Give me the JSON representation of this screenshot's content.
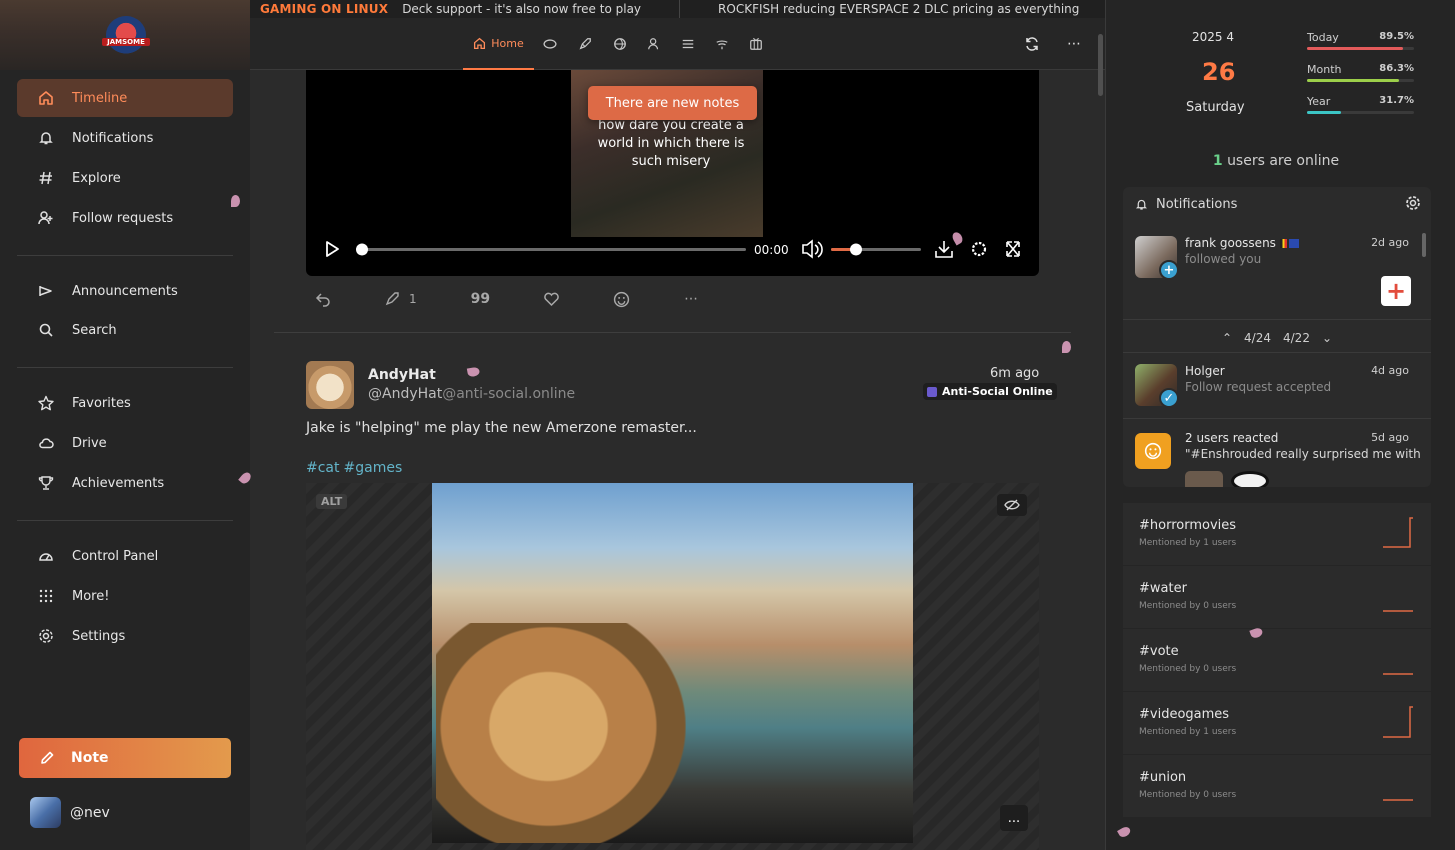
{
  "sidebar": {
    "logo_text": "JAMSOME",
    "items": [
      {
        "label": "Timeline",
        "icon": "home-icon"
      },
      {
        "label": "Notifications",
        "icon": "bell-icon"
      },
      {
        "label": "Explore",
        "icon": "hash-icon"
      },
      {
        "label": "Follow requests",
        "icon": "user-plus-icon"
      },
      {
        "label": "Announcements",
        "icon": "megaphone-icon"
      },
      {
        "label": "Search",
        "icon": "search-icon"
      },
      {
        "label": "Favorites",
        "icon": "star-icon"
      },
      {
        "label": "Drive",
        "icon": "cloud-icon"
      },
      {
        "label": "Achievements",
        "icon": "trophy-icon"
      },
      {
        "label": "Control Panel",
        "icon": "dashboard-icon"
      },
      {
        "label": "More!",
        "icon": "grid-dots-icon"
      },
      {
        "label": "Settings",
        "icon": "gear-icon"
      }
    ],
    "note_label": "Note",
    "account_handle": "@nev",
    "active_color": "#ff8c5a"
  },
  "ticker": {
    "source": "GAMING ON LINUX",
    "item1": "Deck support - it's also now free to play",
    "item2": "ROCKFISH reducing EVERSPACE 2 DLC pricing as everything"
  },
  "topbar": {
    "home_label": "Home"
  },
  "post1": {
    "caption": "how dare you create a world in which there is such misery",
    "new_notes": "There are new notes",
    "time": "00:00",
    "boost_count": "1"
  },
  "post2": {
    "name": "AndyHat",
    "handle_user": "@AndyHat",
    "handle_host": "@anti-social.online",
    "time": "6m ago",
    "instance": "Anti-Social Online",
    "text": "Jake is \"helping\" me play the new Amerzone remaster...",
    "tags": [
      "#cat",
      "#games"
    ],
    "alt_label": "ALT",
    "more": "..."
  },
  "right": {
    "clock": {
      "year_month": "2025  4",
      "day": "26",
      "weekday": "Saturday"
    },
    "progress": [
      {
        "label": "Today",
        "value": "89.5%",
        "fraction": 0.895,
        "color": "#e35b5b"
      },
      {
        "label": "Month",
        "value": "86.3%",
        "fraction": 0.863,
        "color": "#9ccf4a"
      },
      {
        "label": "Year",
        "value": "31.7%",
        "fraction": 0.317,
        "color": "#3cc6c6"
      }
    ],
    "online_count": "1",
    "online_text": "users are online",
    "notifications": {
      "title": "Notifications",
      "items": [
        {
          "who": "frank goossens",
          "what": "followed you",
          "ago": "2d ago",
          "badge": "+"
        },
        {
          "who": "Holger",
          "what": "Follow request accepted",
          "ago": "4d ago",
          "badge": "✓"
        },
        {
          "who": "2 users reacted",
          "what": "\"#Enshrouded really surprised me with",
          "ago": "5d ago"
        }
      ],
      "follow_back": "+",
      "pager_prev": "4/24",
      "pager_next": "4/22"
    },
    "trends": [
      {
        "tag": "#horrormovies",
        "sub": "Mentioned by 1 users"
      },
      {
        "tag": "#water",
        "sub": "Mentioned by 0 users"
      },
      {
        "tag": "#vote",
        "sub": "Mentioned by 0 users"
      },
      {
        "tag": "#videogames",
        "sub": "Mentioned by 1 users"
      },
      {
        "tag": "#union",
        "sub": "Mentioned by 0 users"
      }
    ],
    "trend_color": "#e06a45"
  }
}
